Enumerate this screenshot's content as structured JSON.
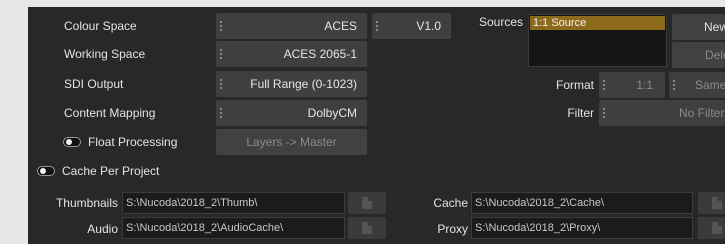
{
  "settings": {
    "colour_space": {
      "label": "Colour Space",
      "value": "ACES",
      "version": "V1.0"
    },
    "working_space": {
      "label": "Working Space",
      "value": "ACES 2065-1"
    },
    "sdi_output": {
      "label": "SDI Output",
      "value": "Full Range (0-1023)"
    },
    "content_mapping": {
      "label": "Content Mapping",
      "value": "DolbyCM"
    },
    "float_processing": {
      "label": "Float Processing",
      "value": "Layers -> Master"
    },
    "cache_per_project": {
      "label": "Cache Per Project"
    }
  },
  "sources": {
    "label": "Sources",
    "items": [
      "1:1 Source"
    ],
    "new_label": "New",
    "delete_label": "Delete",
    "format": {
      "label": "Format",
      "value": "1:1",
      "mode": "Same"
    },
    "filter": {
      "label": "Filter",
      "value": "No Filter"
    }
  },
  "paths": {
    "thumbnails": {
      "label": "Thumbnails",
      "value": "S:\\Nucoda\\2018_2\\Thumb\\"
    },
    "audio": {
      "label": "Audio",
      "value": "S:\\Nucoda\\2018_2\\AudioCache\\"
    },
    "cache": {
      "label": "Cache",
      "value": "S:\\Nucoda\\2018_2\\Cache\\"
    },
    "proxy": {
      "label": "Proxy",
      "value": "S:\\Nucoda\\2018_2\\Proxy\\"
    }
  },
  "icons": {
    "grip": "grip-dots-icon",
    "browse": "document-icon",
    "toggle": "toggle-switch-icon"
  }
}
